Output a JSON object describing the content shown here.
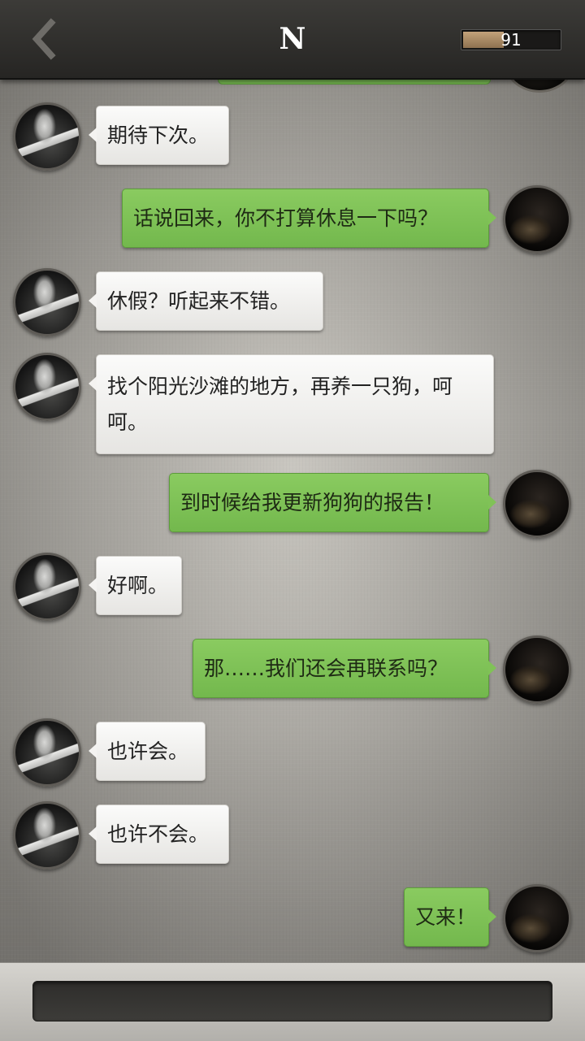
{
  "header": {
    "title": "N",
    "meter_value": "91",
    "meter_fill_fraction": 0.42
  },
  "messages": [
    {
      "side": "left",
      "text": "期待下次。"
    },
    {
      "side": "right",
      "text": "话说回来，你不打算休息一下吗？"
    },
    {
      "side": "left",
      "text": "休假？听起来不错。"
    },
    {
      "side": "left",
      "text": "找个阳光沙滩的地方，再养一只狗，呵呵。"
    },
    {
      "side": "right",
      "text": "到时候给我更新狗狗的报告！"
    },
    {
      "side": "left",
      "text": "好啊。"
    },
    {
      "side": "right",
      "text": "那……我们还会再联系吗？"
    },
    {
      "side": "left",
      "text": "也许会。"
    },
    {
      "side": "left",
      "text": "也许不会。"
    },
    {
      "side": "right",
      "text": "又来！"
    }
  ],
  "input": {
    "value": ""
  },
  "colors": {
    "outgoing_bubble": "#7cc055",
    "incoming_bubble": "#f2f1ee",
    "top_bar": "#2f2e2b",
    "meter_fill": "#b08f68"
  },
  "icons": {
    "back": "chevron-left-icon"
  }
}
